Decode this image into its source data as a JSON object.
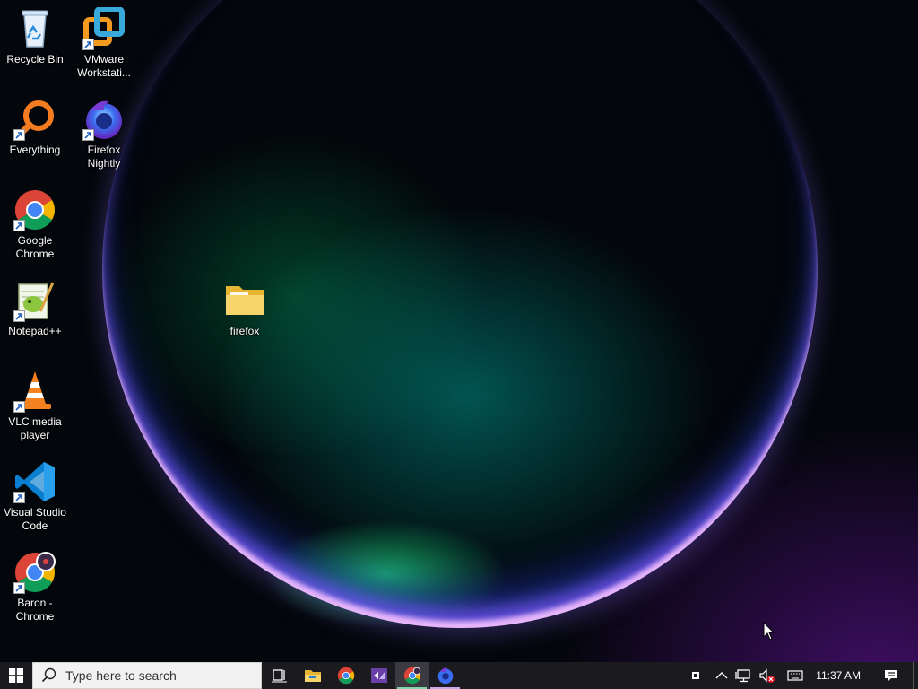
{
  "desktop": {
    "icons": [
      {
        "id": "recycle-bin",
        "label": "Recycle Bin"
      },
      {
        "id": "vmware",
        "label": "VMware\nWorkstati..."
      },
      {
        "id": "everything",
        "label": "Everything"
      },
      {
        "id": "firefox-nightly",
        "label": "Firefox\nNightly"
      },
      {
        "id": "google-chrome",
        "label": "Google\nChrome"
      },
      {
        "id": "notepadpp",
        "label": "Notepad++"
      },
      {
        "id": "firefox-folder",
        "label": "firefox"
      },
      {
        "id": "vlc",
        "label": "VLC media\nplayer"
      },
      {
        "id": "vscode",
        "label": "Visual Studio\nCode"
      },
      {
        "id": "baron-chrome",
        "label": "Baron -\nChrome"
      }
    ]
  },
  "taskbar": {
    "search": {
      "placeholder": "Type here to search"
    },
    "pinned": [
      {
        "name": "Task View",
        "icon": "task-view-icon"
      },
      {
        "name": "File Explorer",
        "icon": "file-explorer-icon"
      },
      {
        "name": "Google Chrome",
        "icon": "chrome-icon"
      },
      {
        "name": "Visual Studio",
        "icon": "visual-studio-icon"
      },
      {
        "name": "Chrome (active)",
        "icon": "chrome-icon"
      },
      {
        "name": "Firefox Nightly",
        "icon": "firefox-nightly-icon"
      }
    ],
    "tray": {
      "clock": "11:37 AM"
    }
  },
  "colors": {
    "taskbar_bg": "#1b1b1f",
    "active_underline": "#7fd1a8",
    "pinned_underline": "#c9a6e8"
  }
}
